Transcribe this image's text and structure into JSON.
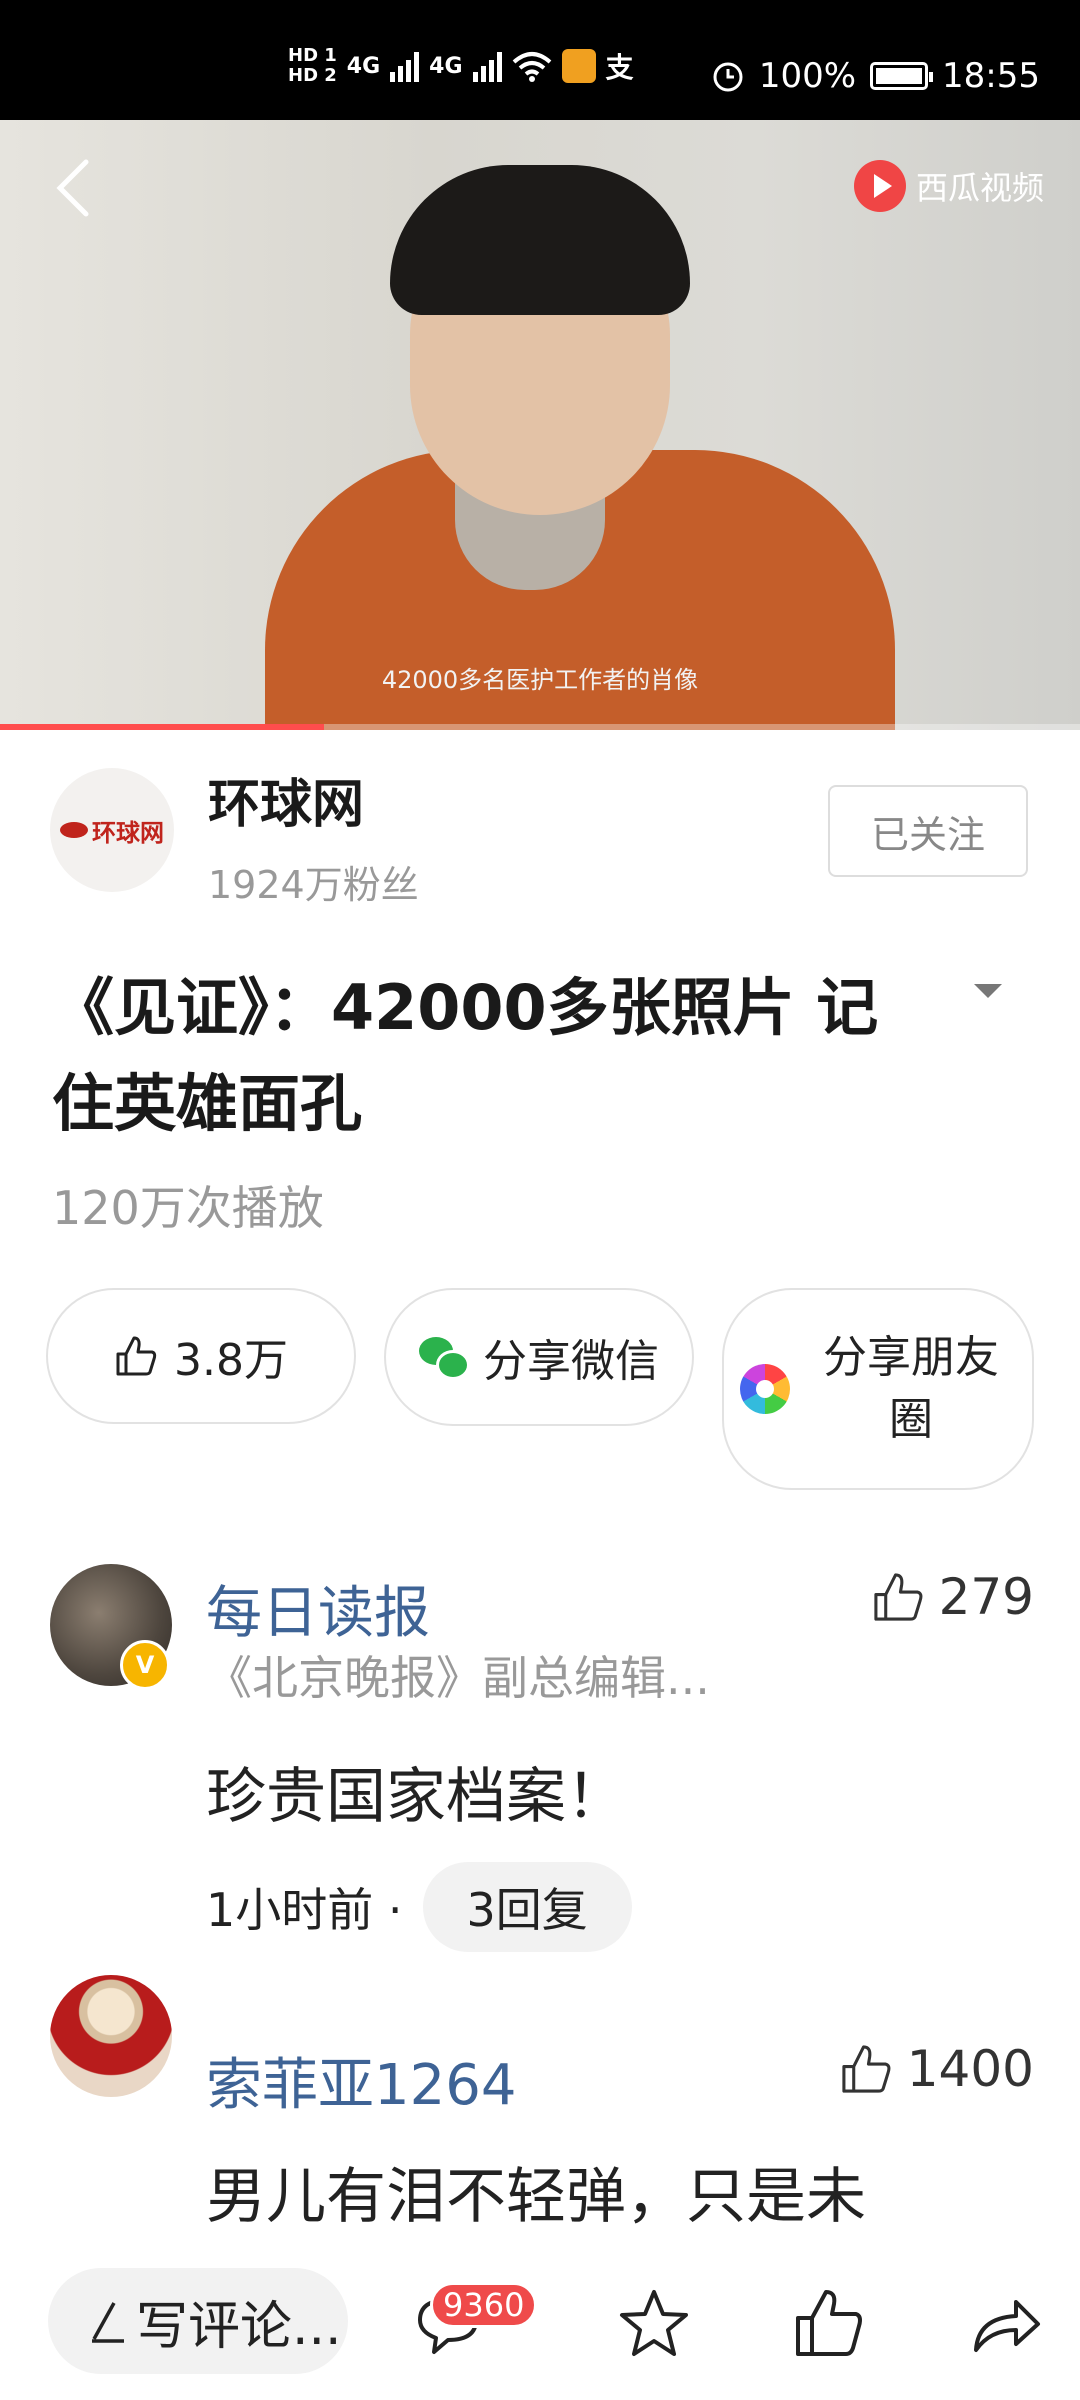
{
  "status_bar": {
    "hd1": "HD 1",
    "hd2": "HD 2",
    "net1": "4G",
    "net2": "4G",
    "pay_glyph": "支",
    "battery": "100%",
    "time": "18:55"
  },
  "video": {
    "platform": "西瓜视频",
    "caption": "42000多名医护工作者的肖像",
    "progress": 0.3
  },
  "account": {
    "logo_text": "环球网",
    "name": "环球网",
    "fans": "1924万粉丝",
    "follow_label": "已关注"
  },
  "article": {
    "title": "《见证》：42000多张照片 记住英雄面孔",
    "plays": "120万次播放"
  },
  "actions": {
    "like": "3.8万",
    "share_wechat": "分享微信",
    "share_moments": "分享朋友圈"
  },
  "comments": [
    {
      "name": "每日读报",
      "verified_badge": "V",
      "subtitle": "《北京晚报》副总编辑...",
      "likes": "279",
      "body": "珍贵国家档案！",
      "time": "1小时前 ·",
      "replies": "3回复"
    },
    {
      "name": "索菲亚1264",
      "likes": "1400",
      "body": "男儿有泪不轻弹，只是未"
    }
  ],
  "bottom_bar": {
    "write_placeholder": "写评论...",
    "comment_count": "9360"
  },
  "colors": {
    "accent_red": "#ef4a4a",
    "link_blue": "#3e6395",
    "wechat_green": "#2bb24c"
  },
  "icons": [
    "back-icon",
    "xigua-logo-icon",
    "thumbs-up-icon",
    "wechat-icon",
    "moments-icon",
    "dropdown-icon",
    "pencil-icon",
    "comment-icon",
    "star-icon",
    "share-icon",
    "alarm-icon",
    "wifi-icon",
    "battery-icon"
  ]
}
